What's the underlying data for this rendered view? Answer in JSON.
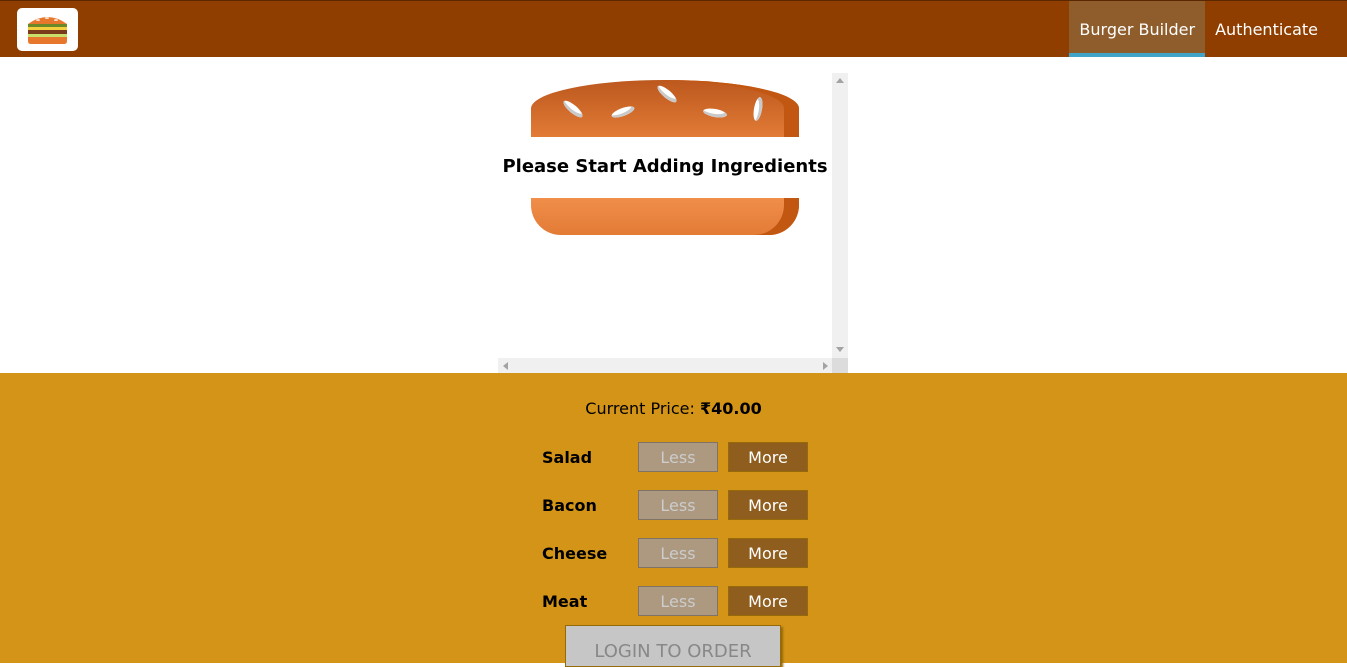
{
  "nav": {
    "items": [
      {
        "label": "Burger Builder",
        "active": true
      },
      {
        "label": "Authenticate",
        "active": false
      }
    ]
  },
  "burger": {
    "empty_message": "Please Start Adding Ingredients"
  },
  "controls": {
    "price_label": "Current Price: ",
    "price_value": "₹40.00",
    "less_label": "Less",
    "more_label": "More",
    "ingredients": [
      {
        "label": "Salad"
      },
      {
        "label": "Bacon"
      },
      {
        "label": "Cheese"
      },
      {
        "label": "Meat"
      }
    ],
    "order_button": "LOGIN TO ORDER"
  },
  "colors": {
    "toolbar": "#8F3E00",
    "controls_bg": "#D39417",
    "active_underline": "#40A4C8",
    "more_button": "#8F5E1E",
    "less_button": "#AC9980"
  }
}
